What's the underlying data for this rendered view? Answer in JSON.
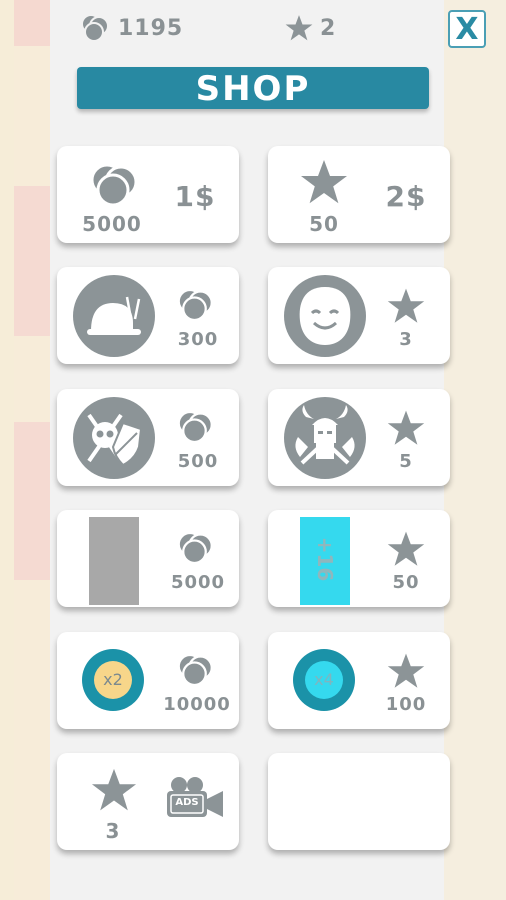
{
  "header": {
    "coins": "1195",
    "stars": "2",
    "close_label": "X",
    "title": "SHOP"
  },
  "items": [
    {
      "id": "coin-pack",
      "amount": "5000",
      "price": "1$"
    },
    {
      "id": "star-pack",
      "amount": "50",
      "price": "2$"
    },
    {
      "id": "snail",
      "cost": "300",
      "currency": "coins"
    },
    {
      "id": "smiley",
      "cost": "3",
      "currency": "stars"
    },
    {
      "id": "skull-shield",
      "cost": "500",
      "currency": "coins"
    },
    {
      "id": "viking",
      "cost": "5",
      "currency": "stars"
    },
    {
      "id": "gray-block",
      "cost": "5000",
      "currency": "coins"
    },
    {
      "id": "cyan-block",
      "label": "+16",
      "cost": "50",
      "currency": "stars"
    },
    {
      "id": "x2-multiplier",
      "label": "x2",
      "cost": "10000",
      "currency": "coins"
    },
    {
      "id": "x4-multiplier",
      "label": "x4",
      "cost": "100",
      "currency": "stars"
    },
    {
      "id": "watch-ads",
      "reward": "3",
      "ads_label": "ADS"
    },
    {
      "id": "empty-slot"
    }
  ],
  "colors": {
    "accent": "#2889a2",
    "icon_gray": "#8c9497",
    "cyan": "#35d9ee",
    "gold": "#f7d68a"
  }
}
